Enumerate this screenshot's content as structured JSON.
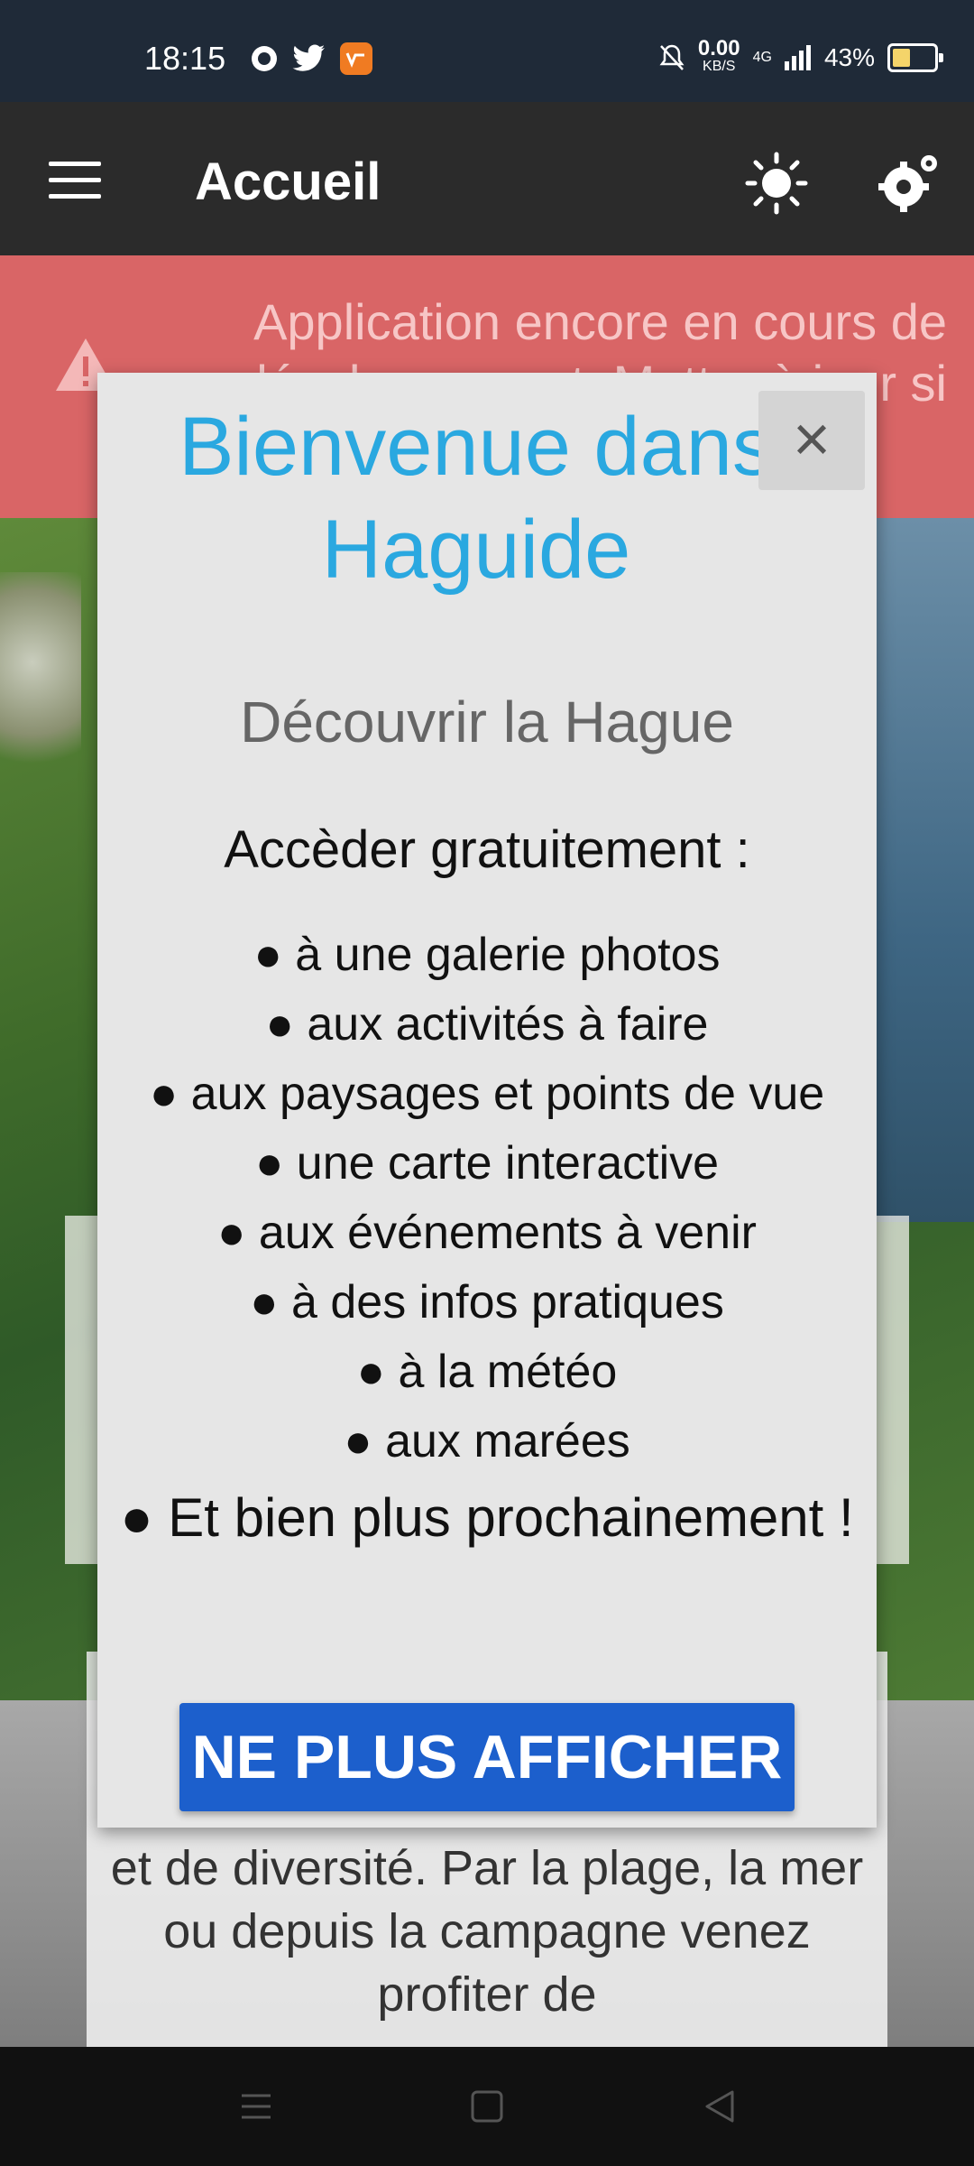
{
  "status_bar": {
    "time": "18:15",
    "net_speed_value": "0.00",
    "net_speed_unit": "KB/S",
    "network": "4G",
    "battery": "43%",
    "battery_level": 0.43
  },
  "app_bar": {
    "title": "Accueil",
    "icons": [
      "menu-icon",
      "sun-icon",
      "gear-icon"
    ]
  },
  "warning_banner": {
    "message": "Application encore en cours de développement. Mettre à jour si"
  },
  "background_card": {
    "text": "et de diversité. Par la plage, la mer ou depuis la campagne venez profiter de"
  },
  "dialog": {
    "title": "Bienvenue dans Haguide",
    "close_label": "×",
    "subtitle": "Découvrir la Hague",
    "intro": "Accèder gratuitement :",
    "features": [
      "● à une galerie photos",
      "● aux activités à faire",
      "● aux paysages et points de vue",
      "● une carte interactive",
      "● aux événements à venir",
      "● à des infos pratiques",
      "● à la météo",
      "● aux marées"
    ],
    "more": "● Et bien plus prochainement !",
    "button_label": "NE PLUS AFFICHER",
    "title_color": "#2aa8e0",
    "button_color": "#1c5fcc"
  },
  "nav_bar": {
    "icons": [
      "recents-icon",
      "home-icon",
      "back-icon"
    ]
  }
}
